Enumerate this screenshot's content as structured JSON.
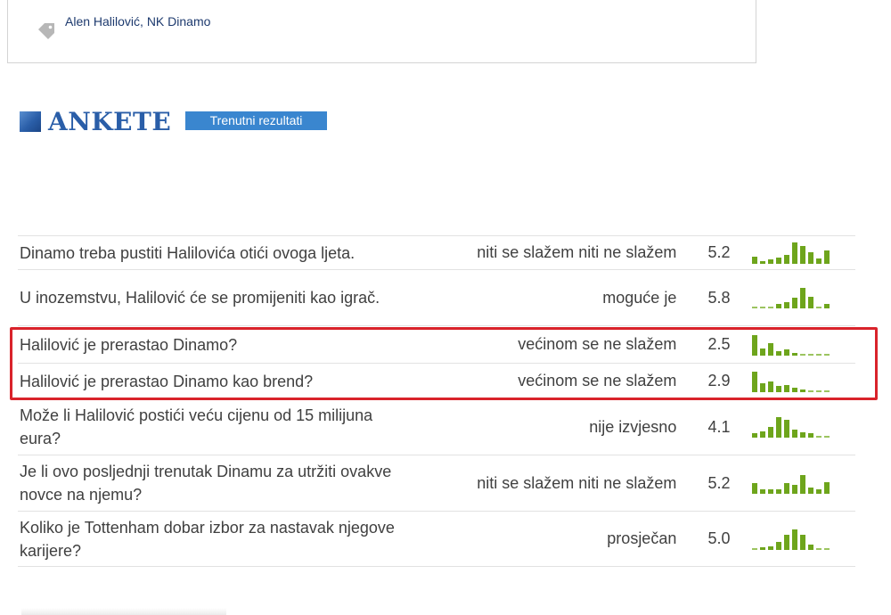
{
  "tags": {
    "text": "Alen Halilović, NK Dinamo",
    "icon": "tag-icon"
  },
  "section": {
    "title": "ANKETE",
    "badge": "Trenutni rezultati",
    "accent": "#2a5ea8"
  },
  "colors": {
    "bar": "#6ea51c",
    "highlight": "#d9232b",
    "badge": "#3a86cf"
  },
  "rows": [
    {
      "question": "Dinamo treba pustiti Halilovića otići ovoga ljeta.",
      "answer": "niti se slažem niti ne slažem",
      "score": "5.2",
      "dist": [
        0.35,
        0.12,
        0.22,
        0.28,
        0.42,
        1.0,
        0.85,
        0.55,
        0.25,
        0.62
      ]
    },
    {
      "question": "U inozemstvu, Halilović će se promijeniti kao igrač.",
      "answer": "moguće je",
      "score": "5.8",
      "dist": [
        0.08,
        0.08,
        0.08,
        0.2,
        0.28,
        0.48,
        0.95,
        0.55,
        0.08,
        0.2
      ]
    },
    {
      "question": "Halilović je prerastao Dinamo?",
      "answer": "većinom se ne slažem",
      "score": "2.5",
      "dist": [
        0.95,
        0.35,
        0.6,
        0.22,
        0.28,
        0.12,
        0.08,
        0.08,
        0.08,
        0.08
      ]
    },
    {
      "question": "Halilović je prerastao Dinamo kao brend?",
      "answer": "većinom se ne slažem",
      "score": "2.9",
      "dist": [
        0.95,
        0.42,
        0.5,
        0.3,
        0.35,
        0.22,
        0.12,
        0.08,
        0.08,
        0.08
      ]
    },
    {
      "question": "Može li Halilović postići veću cijenu od 15 milijuna eura?",
      "answer": "nije izvjesno",
      "score": "4.1",
      "dist": [
        0.22,
        0.28,
        0.5,
        0.95,
        0.82,
        0.38,
        0.25,
        0.2,
        0.08,
        0.08
      ]
    },
    {
      "question": "Je li ovo posljednji trenutak Dinamu za utržiti ovakve novce na njemu?",
      "answer": "niti se slažem niti ne slažem",
      "score": "5.2",
      "dist": [
        0.48,
        0.2,
        0.2,
        0.22,
        0.5,
        0.42,
        0.88,
        0.28,
        0.22,
        0.55
      ]
    },
    {
      "question": "Koliko je Tottenham dobar izbor za nastavak njegove karijere?",
      "answer": "prosječan",
      "score": "5.0",
      "dist": [
        0.08,
        0.12,
        0.18,
        0.38,
        0.72,
        0.95,
        0.72,
        0.25,
        0.08,
        0.08
      ]
    }
  ]
}
